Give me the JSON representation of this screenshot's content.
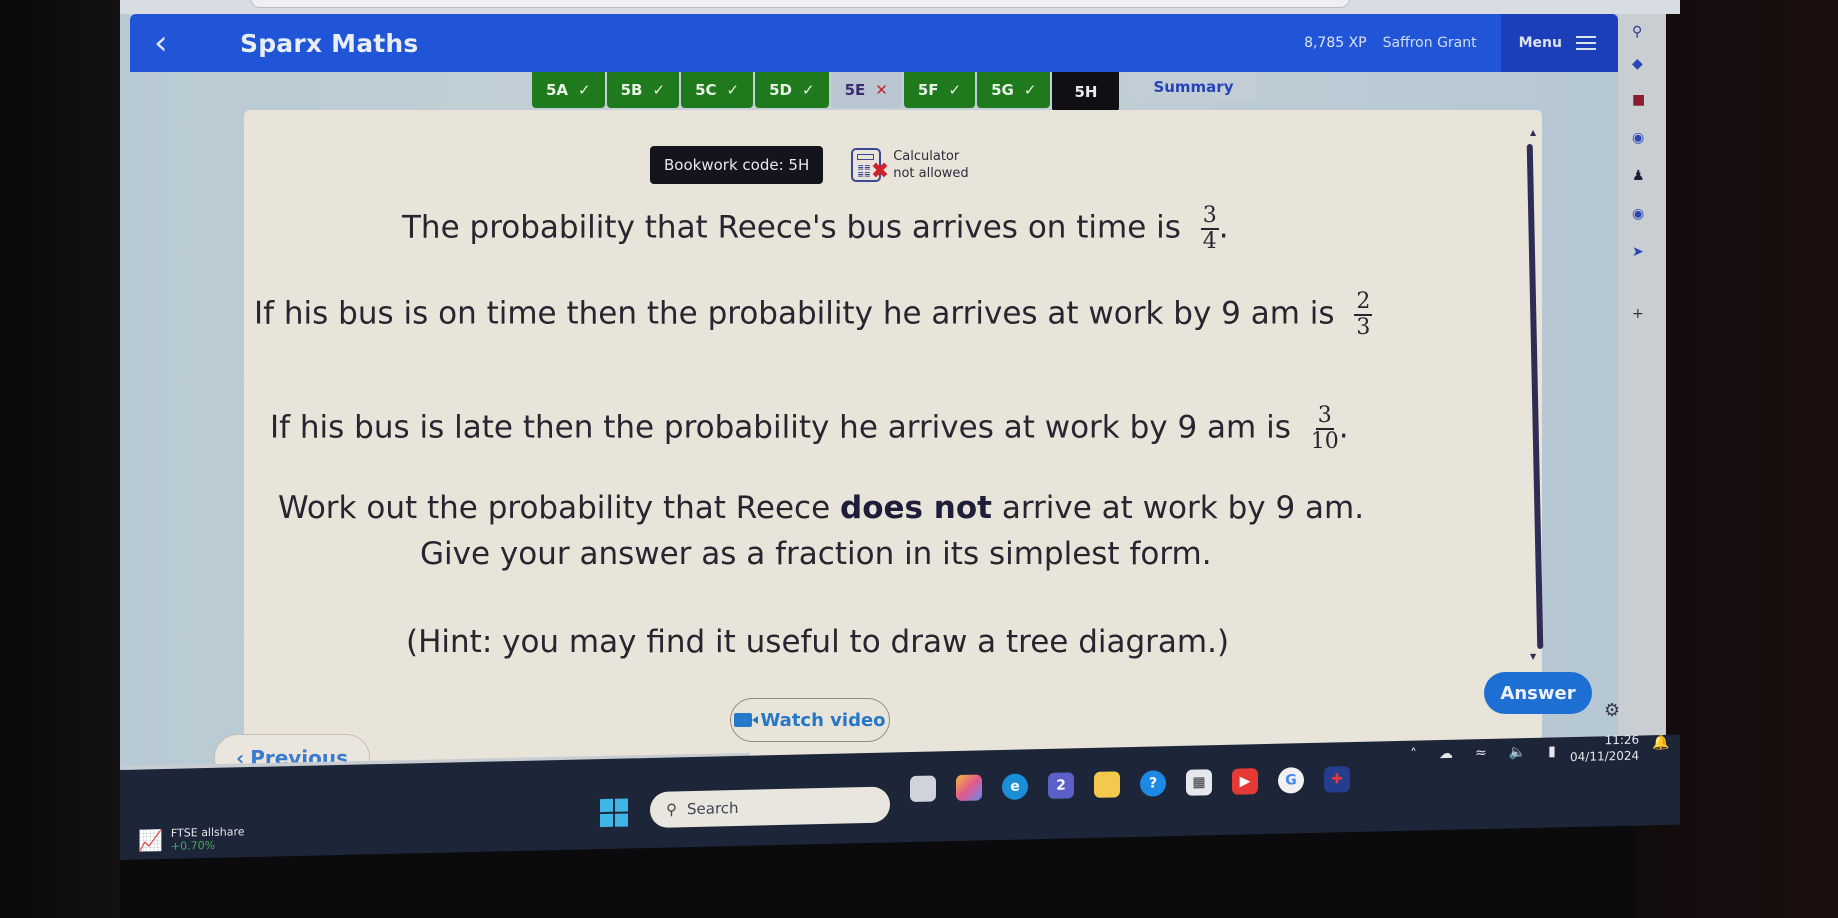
{
  "header": {
    "title": "Sparx Maths",
    "xp": "8,785 XP",
    "user": "Saffron Grant",
    "menu_label": "Menu"
  },
  "tabs": [
    {
      "label": "5A",
      "status": "correct",
      "mark": "✓"
    },
    {
      "label": "5B",
      "status": "correct",
      "mark": "✓"
    },
    {
      "label": "5C",
      "status": "correct",
      "mark": "✓"
    },
    {
      "label": "5D",
      "status": "correct",
      "mark": "✓"
    },
    {
      "label": "5E",
      "status": "incorrect",
      "mark": "✕"
    },
    {
      "label": "5F",
      "status": "correct",
      "mark": "✓"
    },
    {
      "label": "5G",
      "status": "correct",
      "mark": "✓"
    },
    {
      "label": "5H",
      "status": "current",
      "mark": ""
    },
    {
      "label": "Summary",
      "status": "summary",
      "mark": ""
    }
  ],
  "question": {
    "bookwork_code": "Bookwork code: 5H",
    "calculator_line1": "Calculator",
    "calculator_line2": "not allowed",
    "line1_text": "The probability that Reece's bus arrives on time is",
    "line1_frac": {
      "num": "3",
      "den": "4",
      "suffix": "."
    },
    "line2_text": "If his bus is on time then the probability he arrives at work by 9 am is",
    "line2_frac": {
      "num": "2",
      "den": "3",
      "suffix": ""
    },
    "line3_text": "If his bus is late then the probability he arrives at work by 9 am is",
    "line3_frac": {
      "num": "3",
      "den": "10",
      "suffix": "."
    },
    "line4_pre": "Work out the probability that Reece",
    "line4_bold": "does not",
    "line4_post": "arrive at work by 9 am.",
    "line5_text": "Give your answer as a fraction in its simplest form.",
    "hint_text": "(Hint: you may find it useful to draw a tree diagram.)"
  },
  "buttons": {
    "previous": "Previous",
    "watch_video": "Watch video",
    "answer": "Answer"
  },
  "status_url": "https://www.sparxmaths.uk/student/package/2a65c4f3-0fe0-4d48-bebd-374d095c4bb1/task/5/item/8",
  "taskbar": {
    "widget_title": "FTSE allshare",
    "widget_change": "+0.70%",
    "search_placeholder": "Search",
    "time": "11:26",
    "date": "04/11/2024",
    "teams_badge": "2"
  },
  "colors": {
    "brand_blue": "#1f55d6",
    "tab_correct": "#1f7a1e",
    "tab_current": "#0f0f14",
    "answer_button": "#1d6fd4"
  }
}
